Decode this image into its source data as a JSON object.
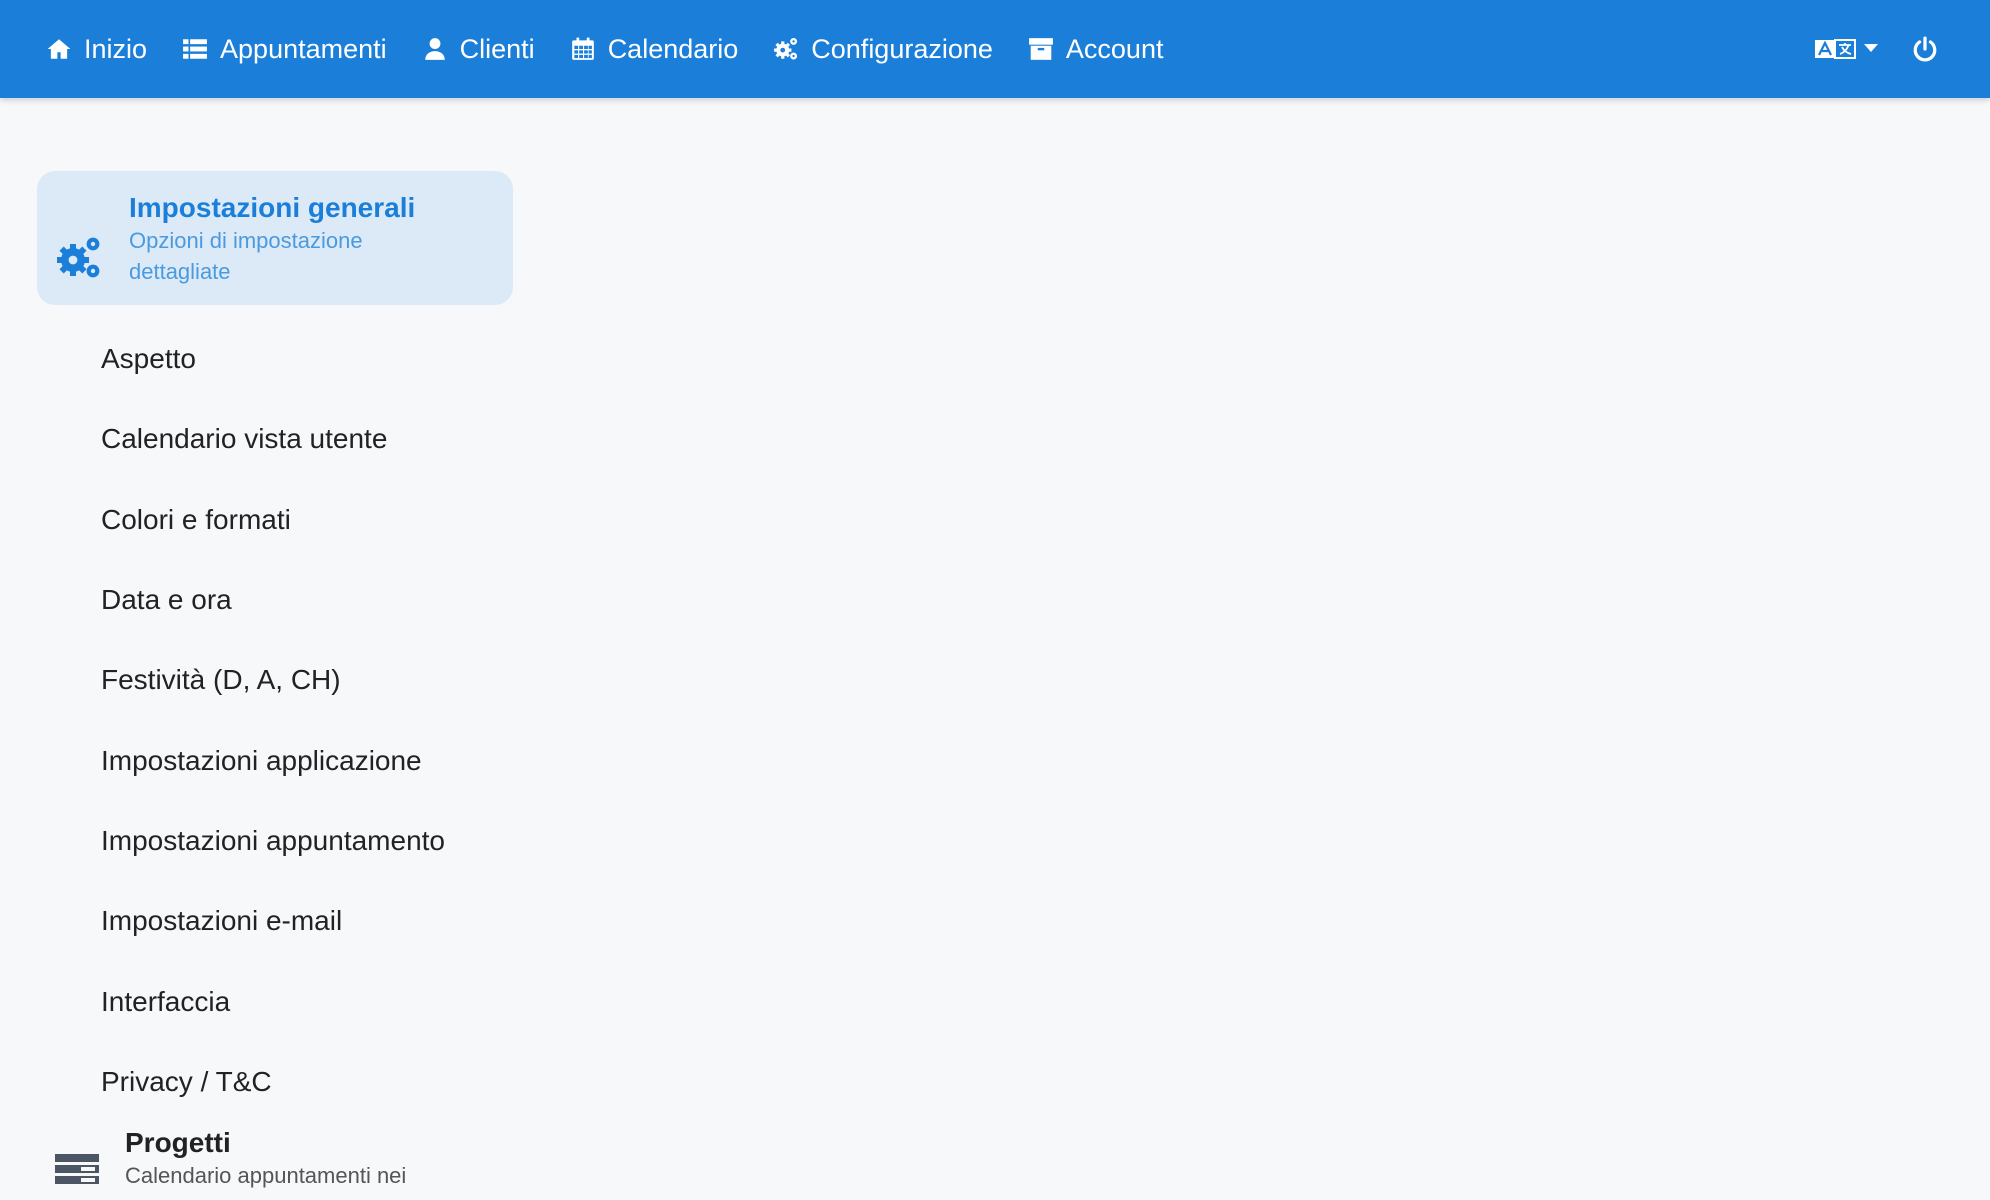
{
  "navbar": {
    "items": [
      {
        "label": "Inizio",
        "icon": "home-icon"
      },
      {
        "label": "Appuntamenti",
        "icon": "list-icon"
      },
      {
        "label": "Clienti",
        "icon": "user-icon"
      },
      {
        "label": "Calendario",
        "icon": "calendar-icon"
      },
      {
        "label": "Configurazione",
        "icon": "gears-icon"
      },
      {
        "label": "Account",
        "icon": "archive-icon"
      }
    ],
    "language_icon": "language-icon",
    "power_icon": "power-icon"
  },
  "sidebar": {
    "active_section": {
      "title": "Impostazioni generali",
      "subtitle": "Opzioni di impostazione dettagliate",
      "icon": "gears-icon"
    },
    "menu": [
      "Aspetto",
      "Calendario vista utente",
      "Colori e formati",
      "Data e ora",
      "Festività (D, A, CH)",
      "Impostazioni applicazione",
      "Impostazioni appuntamento",
      "Impostazioni e-mail",
      "Interfaccia",
      "Privacy / T&C"
    ],
    "next_section": {
      "title": "Progetti",
      "subtitle": "Calendario appuntamenti nei",
      "icon": "server-icon"
    }
  },
  "colors": {
    "navbar": "#1b7fd9",
    "active_bg": "#dceaf7",
    "page_bg": "#f7f8fa"
  }
}
